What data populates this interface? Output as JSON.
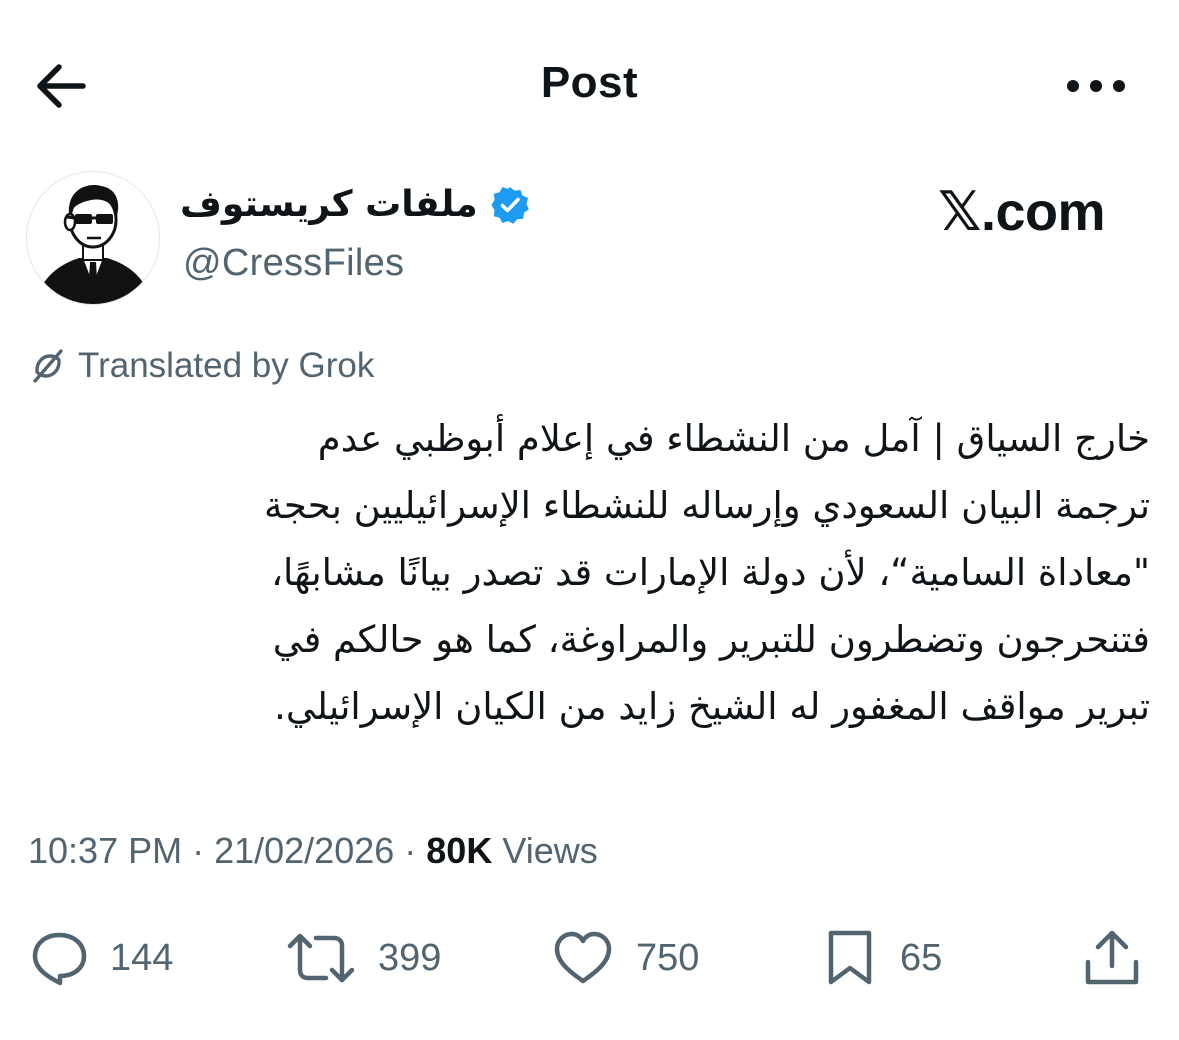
{
  "header": {
    "title": "Post",
    "back_icon": "arrow-left-icon",
    "more_icon": "more-horizontal-icon"
  },
  "author": {
    "display_name": "ملفات كريستوف",
    "handle": "@CressFiles",
    "verified": true,
    "verified_color": "#1d9bf0"
  },
  "watermark": "𝕏.com",
  "translation": {
    "label": "Translated by Grok",
    "icon": "translate-icon"
  },
  "tweet": {
    "lines": [
      "خارج السياق | آمل من النشطاء في إعلام أبوظبي عدم",
      "ترجمة البيان السعودي وإرساله للنشطاء الإسرائيليين بحجة",
      "\"معاداة السامية“، لأن دولة الإمارات قد تصدر بيانًا مشابهًا،",
      "فتنحرجون وتضطرون للتبرير والمراوغة، كما هو حالكم في",
      "تبرير مواقف المغفور له الشيخ زايد من الكيان الإسرائيلي."
    ]
  },
  "meta": {
    "time": "10:37 PM",
    "separator": " · ",
    "date": "21/02/2026",
    "views_count": "80K",
    "views_label": "Views"
  },
  "actions": {
    "replies": "144",
    "reposts": "399",
    "likes": "750",
    "bookmarks": "65"
  },
  "colors": {
    "text_primary": "#0f1419",
    "text_secondary": "#536471",
    "background": "#ffffff"
  }
}
